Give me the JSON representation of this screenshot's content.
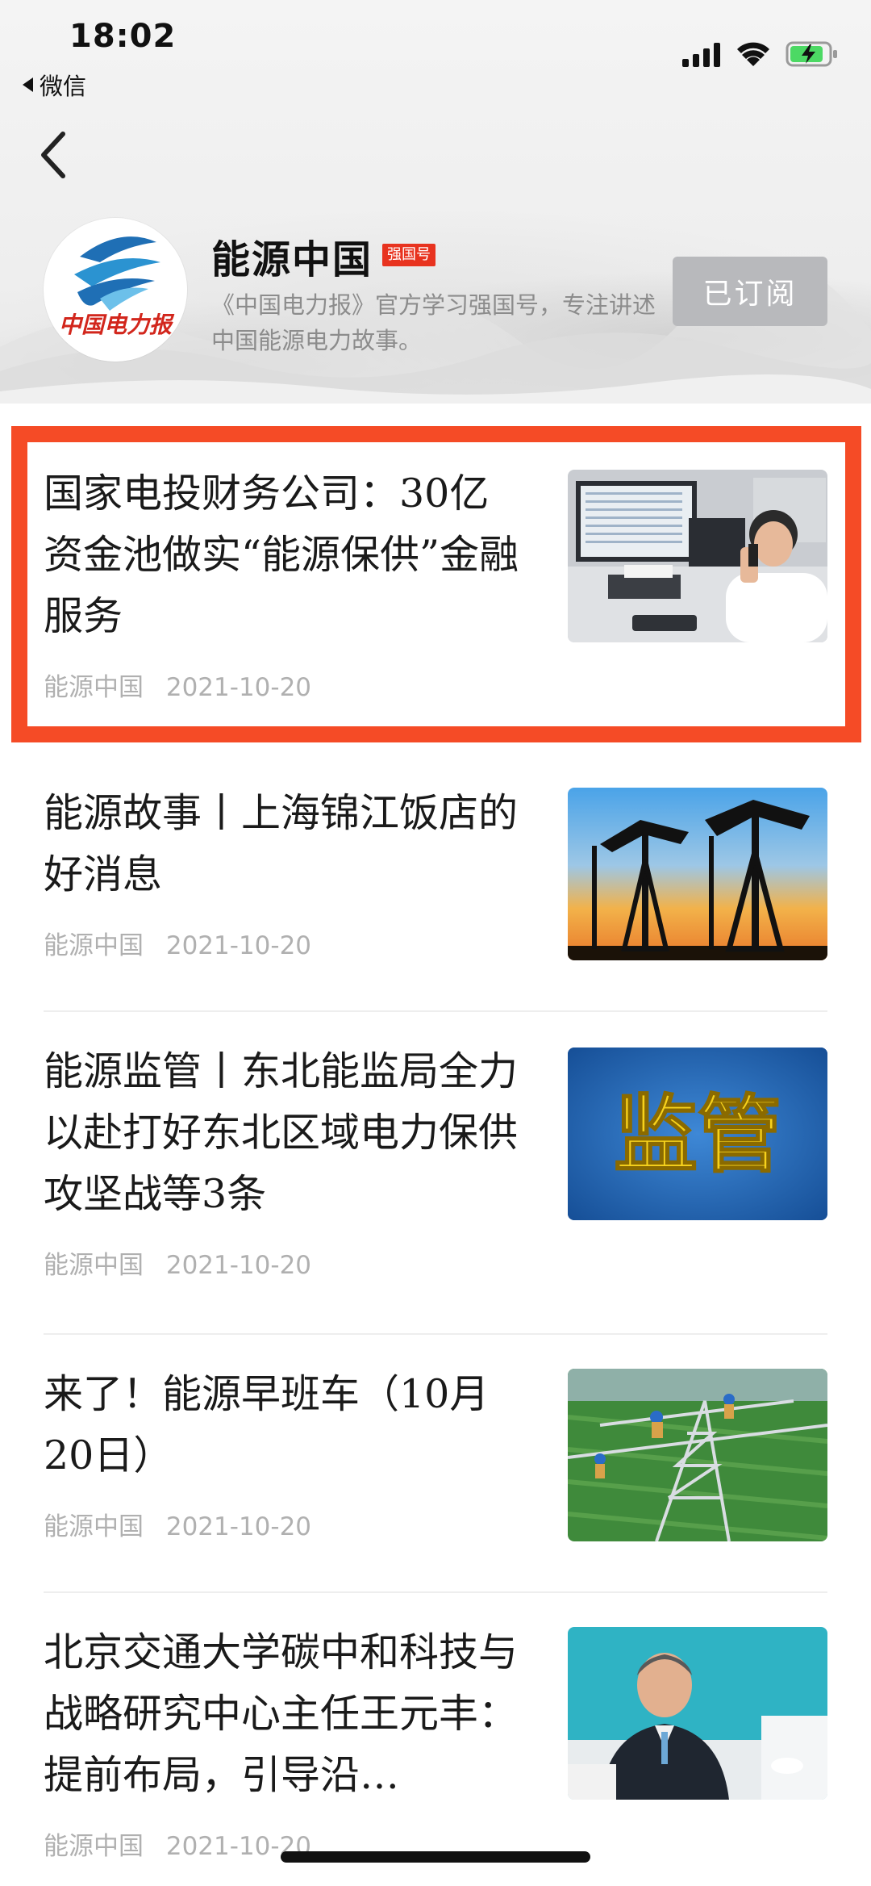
{
  "status_bar": {
    "time": "18:02",
    "back_app_label": "微信",
    "icons": [
      "signal-icon",
      "wifi-icon",
      "battery-charging-icon"
    ]
  },
  "account": {
    "name": "能源中国",
    "badge": "强国号",
    "description": "《中国电力报》官方学习强国号，专注讲述中国能源电力故事。",
    "logo_text": "中国电力报",
    "subscribe_label": "已订阅"
  },
  "articles": [
    {
      "title": "国家电投财务公司：30亿资金池做实“能源保供”金融服务",
      "source": "能源中国",
      "date": "2021-10-20",
      "thumb": "office-worker-phone-photo",
      "highlighted": true
    },
    {
      "title": "能源故事丨上海锦江饭店的好消息",
      "source": "能源中国",
      "date": "2021-10-20",
      "thumb": "oil-pumpjack-sunset-photo"
    },
    {
      "title": "能源监管丨东北能监局全力以赴打好东北区域电力保供攻坚战等3条",
      "source": "能源中国",
      "date": "2021-10-20",
      "thumb": "jianguan-text-image",
      "thumb_text": "监管"
    },
    {
      "title": "来了！能源早班车（10月20日）",
      "source": "能源中国",
      "date": "2021-10-20",
      "thumb": "power-tower-workers-photo"
    },
    {
      "title": "北京交通大学碳中和科技与战略研究中心主任王元丰：提前布局，引导沿…",
      "source": "能源中国",
      "date": "2021-10-20",
      "thumb": "interview-man-photo"
    }
  ],
  "colors": {
    "highlight_border": "#f54b26",
    "badge_red": "#e8331f",
    "subscribe_bg": "#b8b9bc",
    "meta_gray": "#b0b0b0"
  }
}
